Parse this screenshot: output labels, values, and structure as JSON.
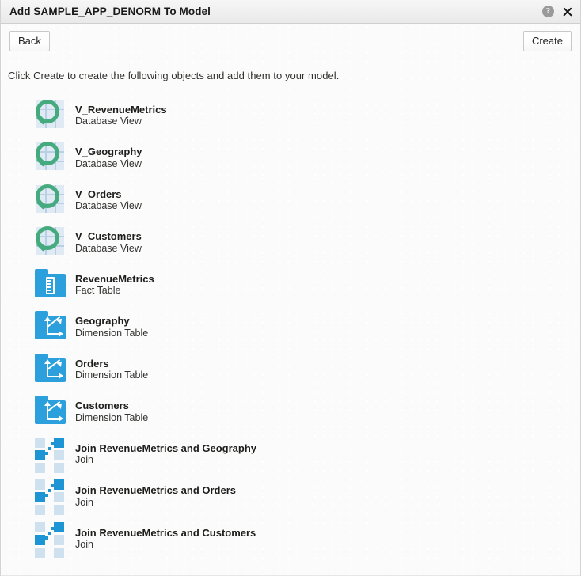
{
  "window": {
    "title": "Add SAMPLE_APP_DENORM To Model",
    "help_icon_glyph": "?",
    "help_icon_name": "help-icon",
    "close_icon_name": "close-icon"
  },
  "toolbar": {
    "back_label": "Back",
    "create_label": "Create"
  },
  "instruction": "Click Create to create the following objects and add them to your model.",
  "colors": {
    "view_green": "#45ab7e",
    "table_blue": "#2ba0dc",
    "join_blue": "#1d95d4",
    "join_light": "#cfe0ef",
    "grid_light": "#dfeaf4",
    "background": "#fbfbfb",
    "titlebar": "#efefef",
    "text_primary": "#1d1d1b",
    "text_secondary": "#333331"
  },
  "objects": [
    {
      "name": "V_RevenueMetrics",
      "type": "Database View",
      "icon": "database-view-icon"
    },
    {
      "name": "V_Geography",
      "type": "Database View",
      "icon": "database-view-icon"
    },
    {
      "name": "V_Orders",
      "type": "Database View",
      "icon": "database-view-icon"
    },
    {
      "name": "V_Customers",
      "type": "Database View",
      "icon": "database-view-icon"
    },
    {
      "name": "RevenueMetrics",
      "type": "Fact Table",
      "icon": "fact-table-icon"
    },
    {
      "name": "Geography",
      "type": "Dimension Table",
      "icon": "dimension-table-icon"
    },
    {
      "name": "Orders",
      "type": "Dimension Table",
      "icon": "dimension-table-icon"
    },
    {
      "name": "Customers",
      "type": "Dimension Table",
      "icon": "dimension-table-icon"
    },
    {
      "name": "Join RevenueMetrics and Geography",
      "type": "Join",
      "icon": "join-icon"
    },
    {
      "name": "Join RevenueMetrics and Orders",
      "type": "Join",
      "icon": "join-icon"
    },
    {
      "name": "Join RevenueMetrics and Customers",
      "type": "Join",
      "icon": "join-icon"
    }
  ]
}
